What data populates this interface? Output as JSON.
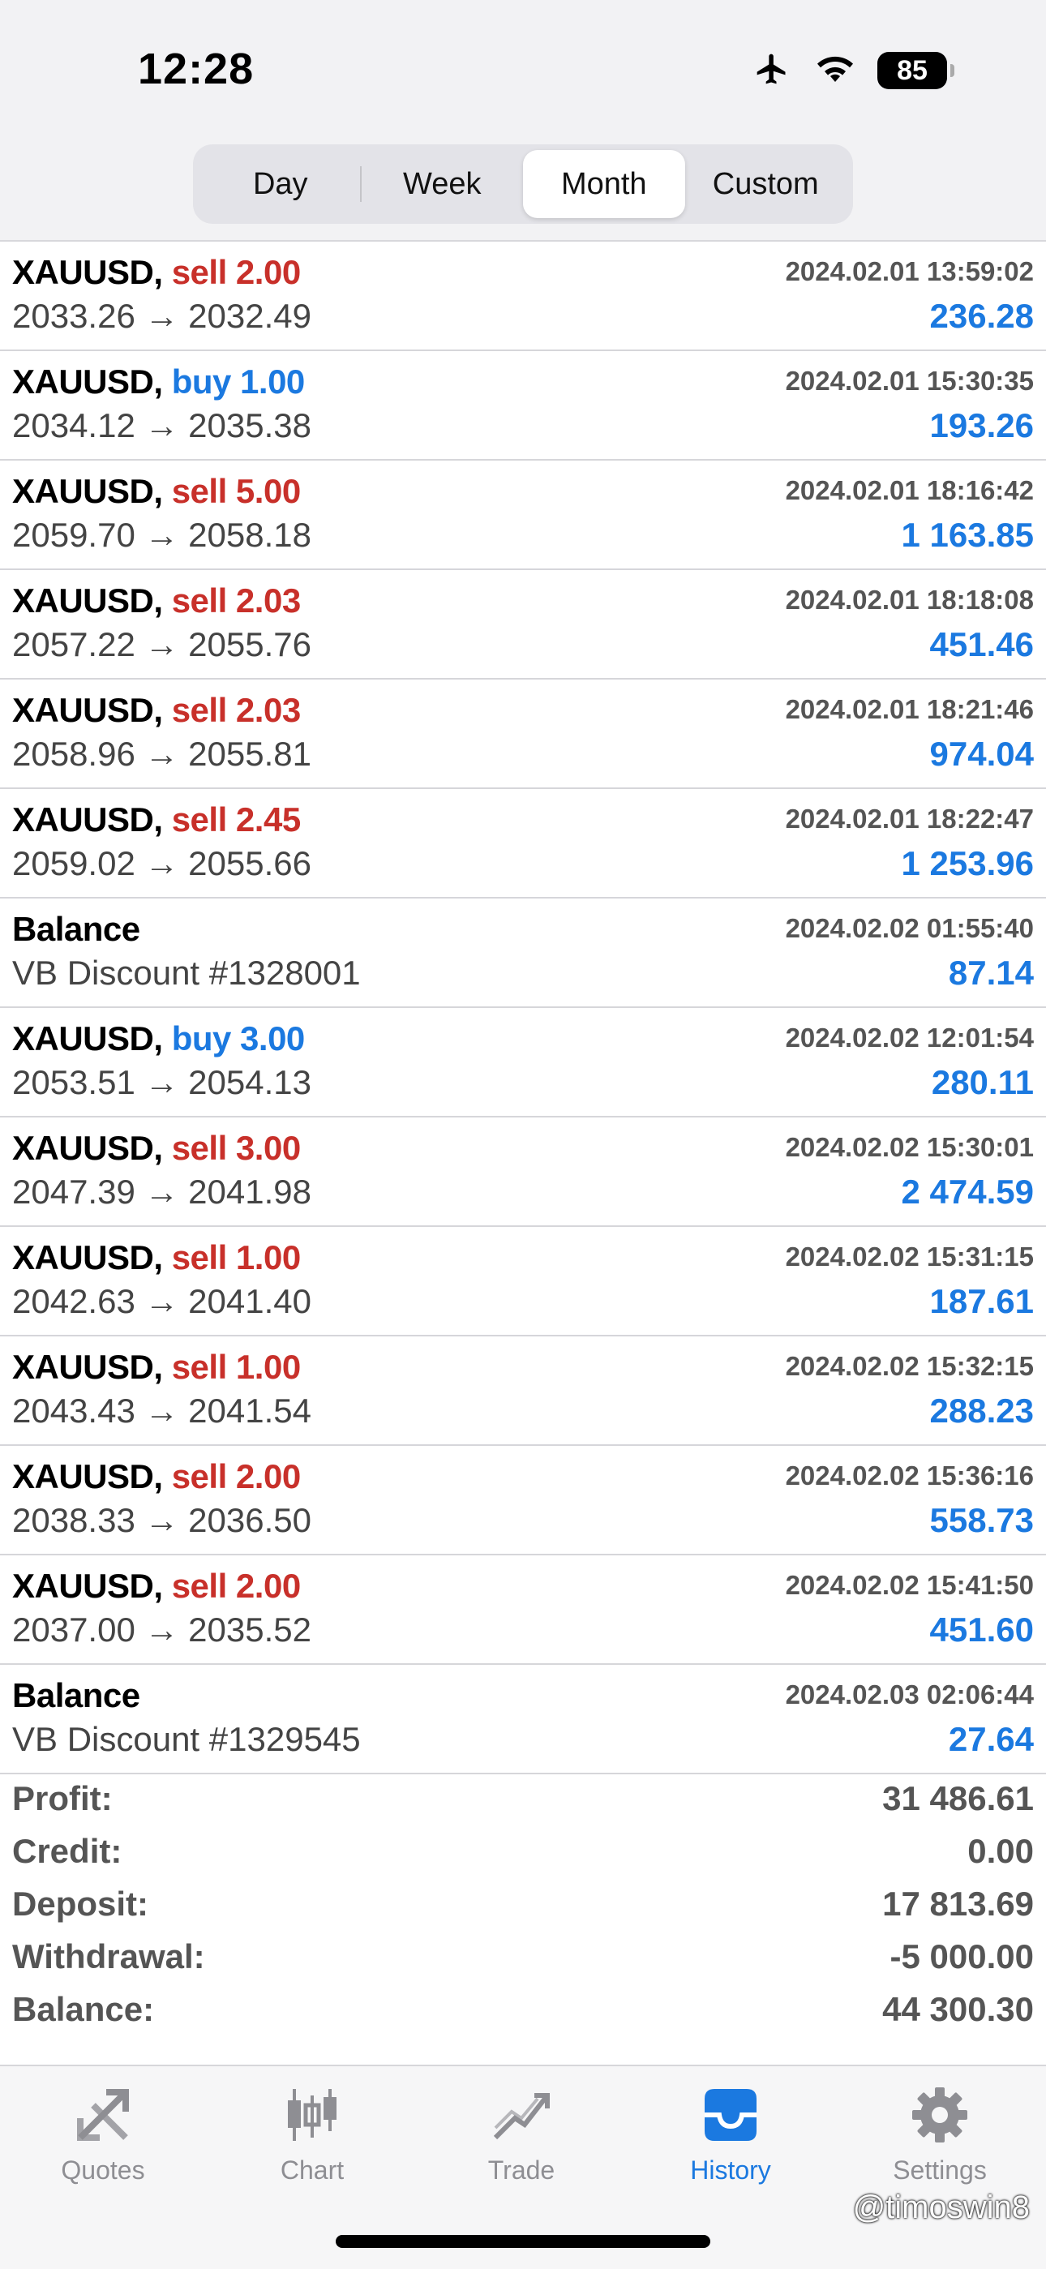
{
  "status_bar": {
    "time": "12:28",
    "battery": "85"
  },
  "segments": [
    {
      "label": "Day",
      "active": false
    },
    {
      "label": "Week",
      "active": false
    },
    {
      "label": "Month",
      "active": true
    },
    {
      "label": "Custom",
      "active": false
    }
  ],
  "deals": [
    {
      "symbol": "XAUUSD,",
      "side": "sell 2.00",
      "side_type": "sell",
      "datetime": "2024.02.01 13:59:02",
      "prices": "2033.26 → 2032.49",
      "profit": "236.28"
    },
    {
      "symbol": "XAUUSD,",
      "side": "buy 1.00",
      "side_type": "buy",
      "datetime": "2024.02.01 15:30:35",
      "prices": "2034.12 → 2035.38",
      "profit": "193.26"
    },
    {
      "symbol": "XAUUSD,",
      "side": "sell 5.00",
      "side_type": "sell",
      "datetime": "2024.02.01 18:16:42",
      "prices": "2059.70 → 2058.18",
      "profit": "1 163.85"
    },
    {
      "symbol": "XAUUSD,",
      "side": "sell 2.03",
      "side_type": "sell",
      "datetime": "2024.02.01 18:18:08",
      "prices": "2057.22 → 2055.76",
      "profit": "451.46"
    },
    {
      "symbol": "XAUUSD,",
      "side": "sell 2.03",
      "side_type": "sell",
      "datetime": "2024.02.01 18:21:46",
      "prices": "2058.96 → 2055.81",
      "profit": "974.04"
    },
    {
      "symbol": "XAUUSD,",
      "side": "sell 2.45",
      "side_type": "sell",
      "datetime": "2024.02.01 18:22:47",
      "prices": "2059.02 → 2055.66",
      "profit": "1 253.96"
    },
    {
      "symbol": "Balance",
      "side": "",
      "side_type": "",
      "datetime": "2024.02.02 01:55:40",
      "prices": "VB Discount #1328001",
      "profit": "87.14"
    },
    {
      "symbol": "XAUUSD,",
      "side": "buy 3.00",
      "side_type": "buy",
      "datetime": "2024.02.02 12:01:54",
      "prices": "2053.51 → 2054.13",
      "profit": "280.11"
    },
    {
      "symbol": "XAUUSD,",
      "side": "sell 3.00",
      "side_type": "sell",
      "datetime": "2024.02.02 15:30:01",
      "prices": "2047.39 → 2041.98",
      "profit": "2 474.59"
    },
    {
      "symbol": "XAUUSD,",
      "side": "sell 1.00",
      "side_type": "sell",
      "datetime": "2024.02.02 15:31:15",
      "prices": "2042.63 → 2041.40",
      "profit": "187.61"
    },
    {
      "symbol": "XAUUSD,",
      "side": "sell 1.00",
      "side_type": "sell",
      "datetime": "2024.02.02 15:32:15",
      "prices": "2043.43 → 2041.54",
      "profit": "288.23"
    },
    {
      "symbol": "XAUUSD,",
      "side": "sell 2.00",
      "side_type": "sell",
      "datetime": "2024.02.02 15:36:16",
      "prices": "2038.33 → 2036.50",
      "profit": "558.73"
    },
    {
      "symbol": "XAUUSD,",
      "side": "sell 2.00",
      "side_type": "sell",
      "datetime": "2024.02.02 15:41:50",
      "prices": "2037.00 → 2035.52",
      "profit": "451.60"
    },
    {
      "symbol": "Balance",
      "side": "",
      "side_type": "",
      "datetime": "2024.02.03 02:06:44",
      "prices": "VB Discount #1329545",
      "profit": "27.64"
    }
  ],
  "summary": [
    {
      "label": "Profit:",
      "value": "31 486.61"
    },
    {
      "label": "Credit:",
      "value": "0.00"
    },
    {
      "label": "Deposit:",
      "value": "17 813.69"
    },
    {
      "label": "Withdrawal:",
      "value": "-5 000.00"
    },
    {
      "label": "Balance:",
      "value": "44 300.30"
    }
  ],
  "tabs": [
    {
      "label": "Quotes",
      "icon": "quotes-icon"
    },
    {
      "label": "Chart",
      "icon": "chart-icon"
    },
    {
      "label": "Trade",
      "icon": "trade-icon"
    },
    {
      "label": "History",
      "icon": "history-icon",
      "active": true
    },
    {
      "label": "Settings",
      "icon": "settings-icon"
    }
  ],
  "watermark": "@timoswin8",
  "colors": {
    "sell": "#c8302a",
    "buy": "#1b79e0",
    "profit": "#1b79e0",
    "tab_active": "#1b79e0",
    "tab_inactive": "#8e8e93"
  }
}
